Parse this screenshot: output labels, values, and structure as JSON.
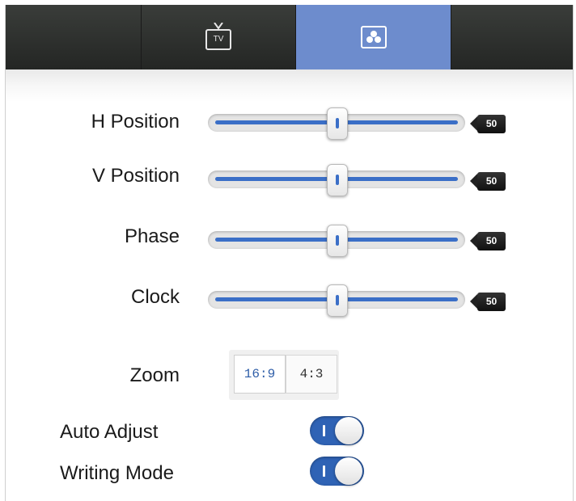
{
  "tabs": [
    {
      "name": "tab-blank-1",
      "icon": ""
    },
    {
      "name": "tab-tv",
      "icon": "tv-icon",
      "icon_text": "TV"
    },
    {
      "name": "tab-picture",
      "icon": "picture-icon",
      "selected": true
    },
    {
      "name": "tab-blank-2",
      "icon": ""
    }
  ],
  "settings": {
    "h_position": {
      "label": "H Position",
      "value": 50,
      "display": "50"
    },
    "v_position": {
      "label": "V Position",
      "value": 50,
      "display": "50"
    },
    "phase": {
      "label": "Phase",
      "value": 50,
      "display": "50"
    },
    "clock": {
      "label": "Clock",
      "value": 50,
      "display": "50"
    },
    "zoom": {
      "label": "Zoom",
      "options": [
        "16:9",
        "4:3"
      ],
      "selected": "16:9"
    },
    "auto_adjust": {
      "label": "Auto Adjust",
      "on": true
    },
    "writing_mode": {
      "label": "Writing Mode",
      "on": true
    }
  },
  "colors": {
    "accent": "#6d8ccd",
    "slider_fill": "#3b6fc7",
    "toggle_on": "#2f63b5",
    "tab_bar": "#2e302e"
  }
}
